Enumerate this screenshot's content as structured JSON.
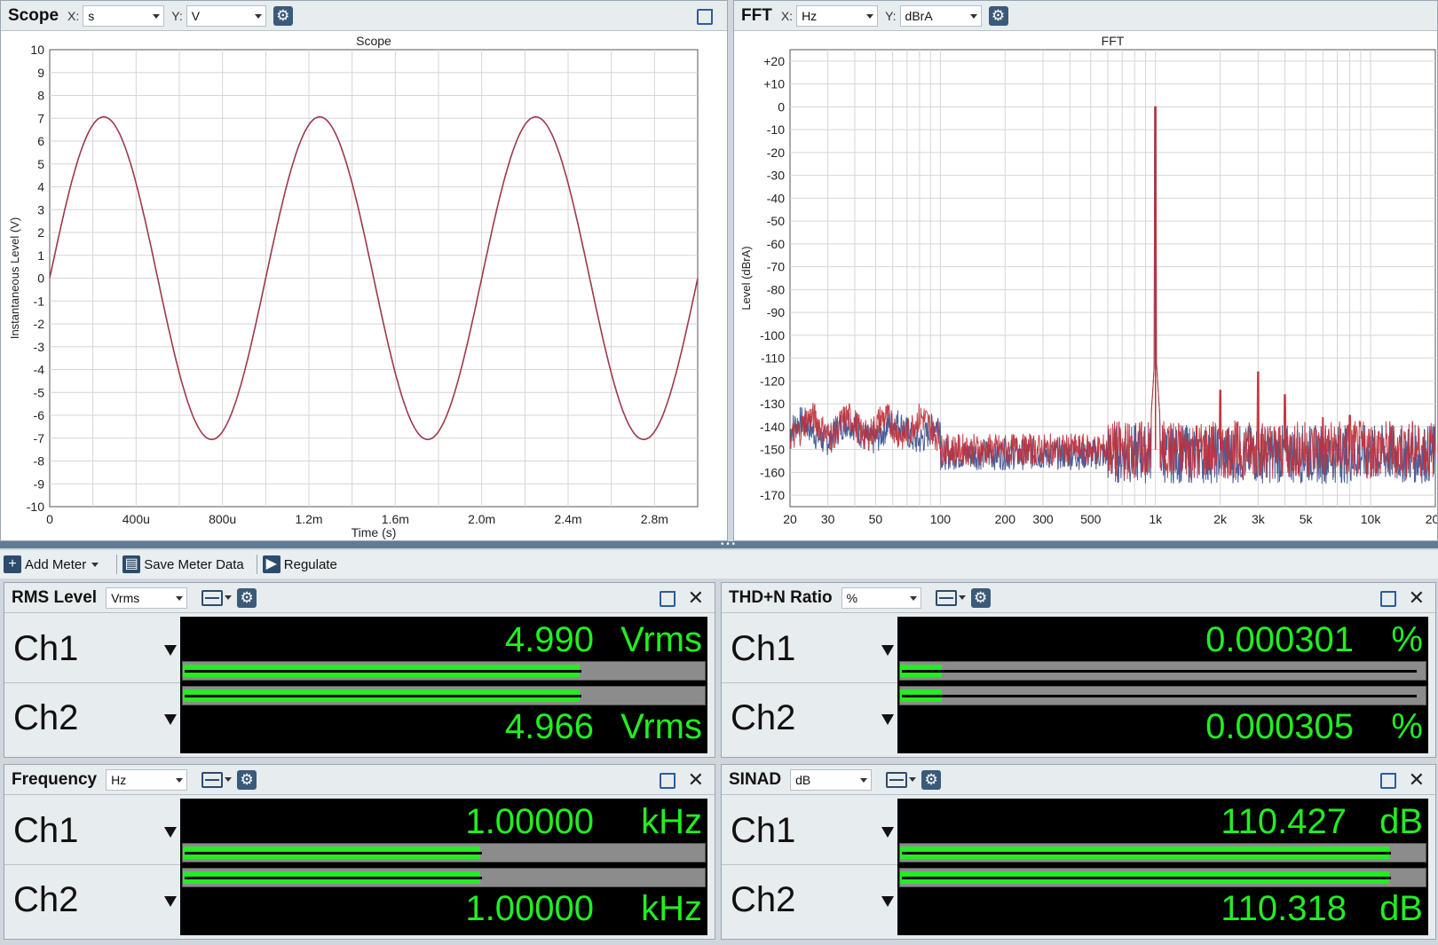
{
  "scope": {
    "title": "Scope",
    "x_label": "X:",
    "x_unit": "s",
    "y_label": "Y:",
    "y_unit": "V",
    "chart_title": "Scope",
    "xlabel": "Time (s)",
    "ylabel": "Instantaneous Level (V)"
  },
  "fft": {
    "title": "FFT",
    "x_label": "X:",
    "x_unit": "Hz",
    "y_label": "Y:",
    "y_unit": "dBrA",
    "chart_title": "FFT",
    "ylabel": "Level (dBrA)"
  },
  "chart_data": [
    {
      "type": "line",
      "title": "Scope",
      "xlabel": "Time (s)",
      "ylabel": "Instantaneous Level (V)",
      "xlim": [
        0,
        0.003
      ],
      "ylim": [
        -10,
        10
      ],
      "x_ticks": [
        "0",
        "400u",
        "800u",
        "1.2m",
        "1.6m",
        "2.0m",
        "2.4m",
        "2.8m"
      ],
      "x_tick_values": [
        0,
        0.0004,
        0.0008,
        0.0012,
        0.0016,
        0.002,
        0.0024,
        0.0028
      ],
      "y_ticks": [
        "10",
        "9",
        "8",
        "7",
        "6",
        "5",
        "4",
        "3",
        "2",
        "1",
        "0",
        "-1",
        "-2",
        "-3",
        "-4",
        "-5",
        "-6",
        "-7",
        "-8",
        "-9",
        "-10"
      ],
      "series": [
        {
          "color": "#9c3a4a",
          "kind": "sine",
          "amplitude": 7.06,
          "frequency": 1000,
          "phase": 0
        }
      ],
      "grid": true
    },
    {
      "type": "line",
      "title": "FFT",
      "xlabel": "",
      "ylabel": "Level (dBrA)",
      "x_scale": "log",
      "xlim": [
        20,
        20000
      ],
      "ylim": [
        -175,
        25
      ],
      "x_ticks": [
        "20",
        "30",
        "50",
        "100",
        "200",
        "300",
        "500",
        "1k",
        "2k",
        "3k",
        "5k",
        "10k",
        "20k"
      ],
      "x_tick_values": [
        20,
        30,
        50,
        100,
        200,
        300,
        500,
        1000,
        2000,
        3000,
        5000,
        10000,
        20000
      ],
      "y_ticks": [
        "+20",
        "+10",
        "0",
        "-10",
        "-20",
        "-30",
        "-40",
        "-50",
        "-60",
        "-70",
        "-80",
        "-90",
        "-100",
        "-110",
        "-120",
        "-130",
        "-140",
        "-150",
        "-160",
        "-170"
      ],
      "y_tick_values": [
        20,
        10,
        0,
        -10,
        -20,
        -30,
        -40,
        -50,
        -60,
        -70,
        -80,
        -90,
        -100,
        -110,
        -120,
        -130,
        -140,
        -150,
        -160,
        -170
      ],
      "series": [
        {
          "color": "#3a4e8c",
          "peaks": [
            {
              "x": 1000,
              "y": 0
            }
          ],
          "noise_floor": -152
        },
        {
          "color": "#c0303a",
          "peaks": [
            {
              "x": 1000,
              "y": 0
            },
            {
              "x": 2000,
              "y": -124
            },
            {
              "x": 3000,
              "y": -116
            },
            {
              "x": 4000,
              "y": -126
            },
            {
              "x": 6000,
              "y": -136
            },
            {
              "x": 8000,
              "y": -135
            }
          ],
          "noise_floor": -150
        }
      ],
      "grid": true
    }
  ],
  "toolbar": {
    "add_meter": "Add Meter",
    "save_meter": "Save Meter Data",
    "regulate": "Regulate"
  },
  "meters": {
    "rms": {
      "title": "RMS Level",
      "unit_select": "Vrms",
      "ch1": {
        "label": "Ch1",
        "value": "4.990",
        "unit": "Vrms",
        "fill": 0.76
      },
      "ch2": {
        "label": "Ch2",
        "value": "4.966",
        "unit": "Vrms",
        "fill": 0.76
      }
    },
    "thd": {
      "title": "THD+N Ratio",
      "unit_select": "%",
      "ch1": {
        "label": "Ch1",
        "value": "0.000301",
        "unit": "%",
        "fill": 0.08
      },
      "ch2": {
        "label": "Ch2",
        "value": "0.000305",
        "unit": "%",
        "fill": 0.08
      }
    },
    "freq": {
      "title": "Frequency",
      "unit_select": "Hz",
      "ch1": {
        "label": "Ch1",
        "value": "1.00000",
        "unit": "kHz",
        "fill": 0.57
      },
      "ch2": {
        "label": "Ch2",
        "value": "1.00000",
        "unit": "kHz",
        "fill": 0.57
      }
    },
    "sinad": {
      "title": "SINAD",
      "unit_select": "dB",
      "ch1": {
        "label": "Ch1",
        "value": "110.427",
        "unit": "dB",
        "fill": 0.93
      },
      "ch2": {
        "label": "Ch2",
        "value": "110.318",
        "unit": "dB",
        "fill": 0.93
      }
    }
  }
}
